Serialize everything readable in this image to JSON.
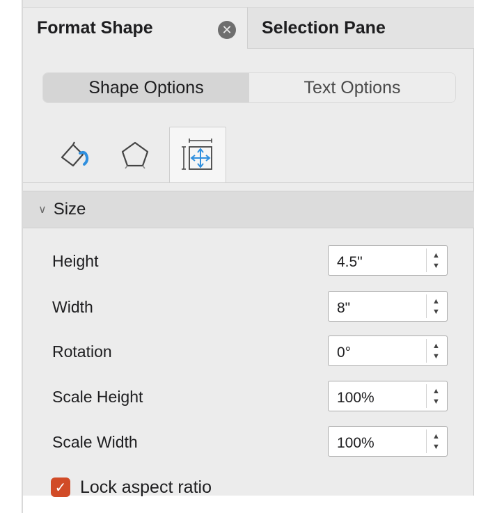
{
  "tabs": {
    "format_shape": "Format Shape",
    "selection_pane": "Selection Pane",
    "close_glyph": "✕"
  },
  "options": {
    "shape_options": "Shape Options",
    "text_options": "Text Options"
  },
  "icon_tabs": [
    "fill-line-icon",
    "effects-pentagon-icon",
    "size-properties-icon"
  ],
  "section": {
    "title": "Size",
    "expanded": true
  },
  "fields": [
    {
      "label": "Height",
      "value": "4.5\""
    },
    {
      "label": "Width",
      "value": "8\""
    },
    {
      "label": "Rotation",
      "value": "0°"
    },
    {
      "label": "Scale Height",
      "value": "100%"
    },
    {
      "label": "Scale Width",
      "value": "100%"
    }
  ],
  "lock_aspect": {
    "label": "Lock aspect ratio",
    "checked": true
  },
  "colors": {
    "accent": "#d14b27",
    "icon_blue": "#2f8fde"
  }
}
